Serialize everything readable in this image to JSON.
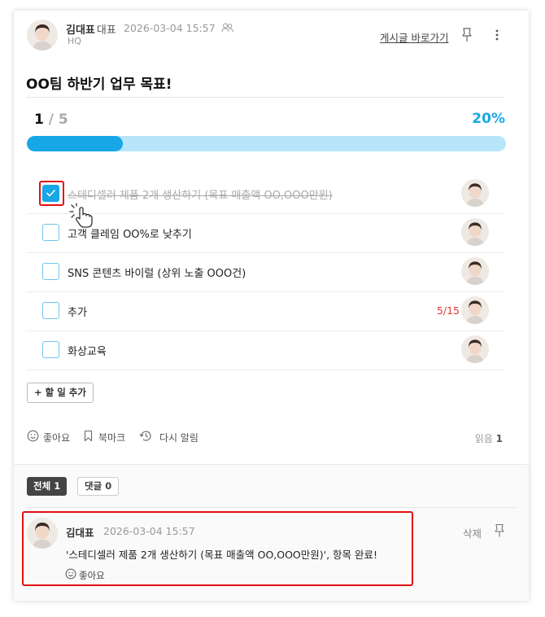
{
  "post": {
    "author_name": "김대표",
    "author_role": "대표",
    "date": "2026-03-04 15:57",
    "team": "HQ",
    "goto_link": "게시글 바로가기",
    "title": "OO팀 하반기 업무 목표!"
  },
  "progress": {
    "done": "1",
    "separator": "/",
    "total": "5",
    "percent_text": "20%",
    "percent_value": 0.2,
    "colors": {
      "fill": "#17a6e6",
      "track": "#b7e6fb"
    }
  },
  "tasks": [
    {
      "label": "스테디셀러 제품 2개 생산하기 (목표 매출액 OO,OOO만원)",
      "checked": true,
      "count": ""
    },
    {
      "label": "고객 클레임 OO%로 낮추기",
      "checked": false,
      "count": ""
    },
    {
      "label": "SNS 콘텐츠 바이럴 (상위 노출 OOO건)",
      "checked": false,
      "count": ""
    },
    {
      "label": "추가",
      "checked": false,
      "count": "5/15"
    },
    {
      "label": "화상교육",
      "checked": false,
      "count": ""
    }
  ],
  "add_task_label": "+ 할 일 추가",
  "actions": {
    "like": "좋아요",
    "bookmark": "북마크",
    "remind": "다시 알림",
    "read_label": "읽음",
    "read_count": "1"
  },
  "comments": {
    "tab_all_label": "전체",
    "tab_all_count": "1",
    "tab_comments_label": "댓글",
    "tab_comments_count": "0",
    "item": {
      "author": "김대표",
      "date": "2026-03-04 15:57",
      "text": "'스테디셀러 제품 2개 생산하기 (목표 매출액 OO,OOO만원)', 항목 완료!",
      "like": "좋아요",
      "delete": "삭제"
    }
  },
  "icons": [
    "person-icon",
    "people-icon",
    "pin-icon",
    "more-icon",
    "check-icon",
    "pointer-cursor-icon",
    "smile-icon",
    "bookmark-icon",
    "reminder-icon"
  ],
  "colors": {
    "accent": "#17a6e6",
    "highlight": "#e01010",
    "count_red": "#e53935"
  }
}
